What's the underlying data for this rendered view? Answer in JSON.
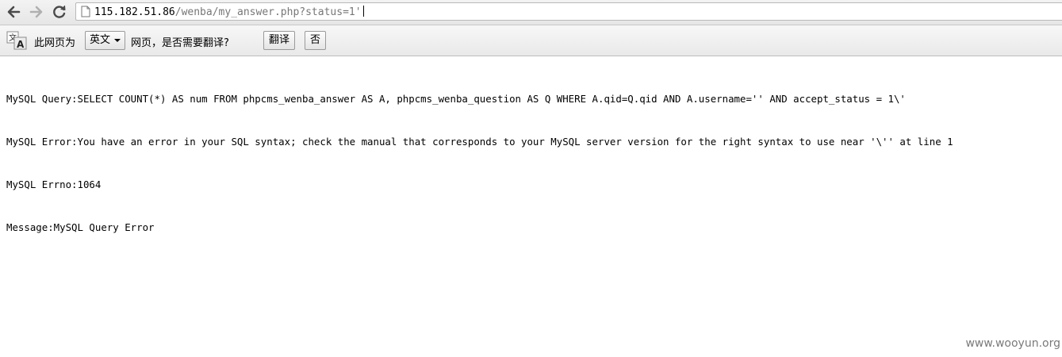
{
  "browser": {
    "url_host": "115.182.51.86",
    "url_path": "/wenba/my_answer.php?status=1'",
    "icons": {
      "back": "back-arrow-icon",
      "forward": "forward-arrow-icon",
      "reload": "reload-icon",
      "page": "page-icon"
    }
  },
  "translate_bar": {
    "prefix": "此网页为",
    "language": "英文",
    "suffix": "网页，是否需要翻译?",
    "translate_button": "翻译",
    "no_button": "否",
    "icon": "translate-icon"
  },
  "page": {
    "lines": [
      "MySQL Query:SELECT COUNT(*) AS num FROM phpcms_wenba_answer AS A, phpcms_wenba_question AS Q WHERE A.qid=Q.qid AND A.username='' AND accept_status = 1\\'",
      "MySQL Error:You have an error in your SQL syntax; check the manual that corresponds to your MySQL server version for the right syntax to use near '\\'' at line 1",
      "MySQL Errno:1064",
      "Message:MySQL Query Error"
    ]
  },
  "watermark": "www.wooyun.org"
}
